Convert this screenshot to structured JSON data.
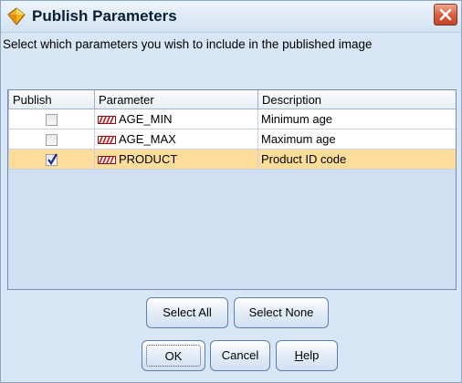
{
  "window": {
    "title": "Publish Parameters"
  },
  "instruction": "Select which parameters you wish to include in the published image",
  "table": {
    "columns": [
      "Publish",
      "Parameter",
      "Description"
    ],
    "rows": [
      {
        "publish": false,
        "parameter": "AGE_MIN",
        "description": "Minimum age",
        "selected": false
      },
      {
        "publish": false,
        "parameter": "AGE_MAX",
        "description": "Maximum age",
        "selected": false
      },
      {
        "publish": true,
        "parameter": "PRODUCT",
        "description": "Product ID code",
        "selected": true
      }
    ]
  },
  "buttons": {
    "select_all": "Select All",
    "select_none": "Select None",
    "ok": "OK",
    "cancel": "Cancel",
    "help_first": "H",
    "help_rest": "elp"
  },
  "icons": {
    "title": "diamond-app-icon",
    "close": "close-icon",
    "parameter": "parameter-icon",
    "check": "checkmark-icon"
  },
  "colors": {
    "selected_row": "#fddd99",
    "dialog_bg": "#d8e6f5",
    "close_button": "#d65a3c"
  }
}
